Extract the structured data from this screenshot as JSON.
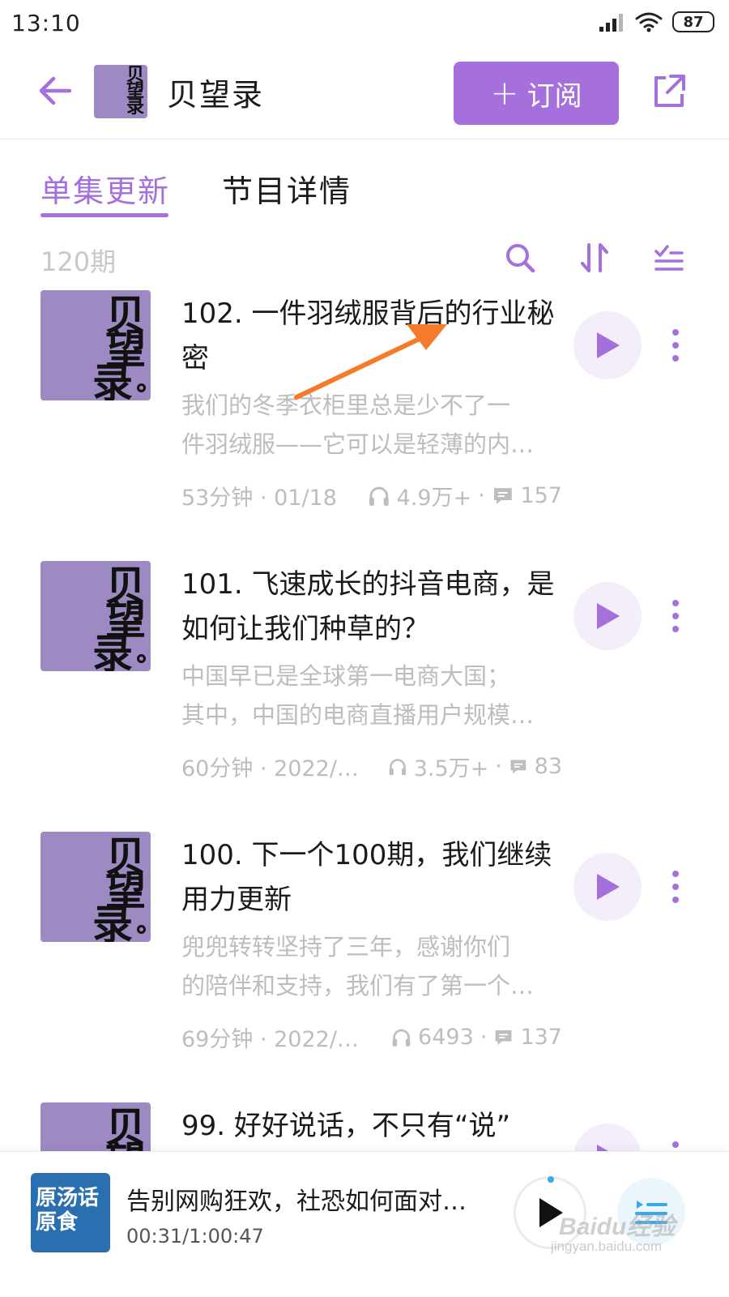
{
  "status_bar": {
    "time": "13:10",
    "battery": "87"
  },
  "header": {
    "title": "贝望录",
    "subscribe_label": "订阅",
    "subscribe_plus": "+",
    "cover_chars": [
      "贝",
      "望",
      "录"
    ]
  },
  "tabs": [
    {
      "label": "单集更新",
      "active": true
    },
    {
      "label": "节目详情",
      "active": false
    }
  ],
  "list_toolbar": {
    "episode_count": "120期"
  },
  "episodes": [
    {
      "title": "102. 一件羽绒服背后的行业秘密",
      "description_lines": [
        "我们的冬季衣柜里总是少不了一",
        "件羽绒服——它可以是轻薄的内…"
      ],
      "duration_date": "53分钟 · 01/18",
      "plays": "4.9万+",
      "separator": "·",
      "comments": "157"
    },
    {
      "title": "101. 飞速成长的抖音电商，是如何让我们种草的？",
      "description_lines": [
        "中国早已是全球第一电商大国；",
        "其中，中国的电商直播用户规模…"
      ],
      "duration_date": "60分钟 · 2022/…",
      "plays": "3.5万+",
      "separator": "·",
      "comments": "83"
    },
    {
      "title": "100. 下一个100期，我们继续用力更新",
      "description_lines": [
        "兜兜转转坚持了三年，感谢你们",
        "的陪伴和支持，我们有了第一个…"
      ],
      "duration_date": "69分钟 · 2022/…",
      "plays": "6493",
      "separator": "·",
      "comments": "137"
    },
    {
      "title": "99. 好好说话，不只有“说”",
      "description_lines": [],
      "duration_date": "",
      "plays": "",
      "separator": "",
      "comments": ""
    }
  ],
  "cover_chars": [
    "贝",
    "望",
    "录"
  ],
  "mini_player": {
    "title": "告别网购狂欢，社恐如何面对…",
    "time": "00:31/1:00:47",
    "cover_text": "原汤话原食"
  },
  "watermark": {
    "text": "Baidu经验",
    "sub": "jingyan.baidu.com"
  },
  "colors": {
    "accent": "#a56fdc",
    "cover_bg": "#9d8ac2",
    "muted_text": "#bdbdbd",
    "annotation_arrow": "#f47b2a"
  }
}
